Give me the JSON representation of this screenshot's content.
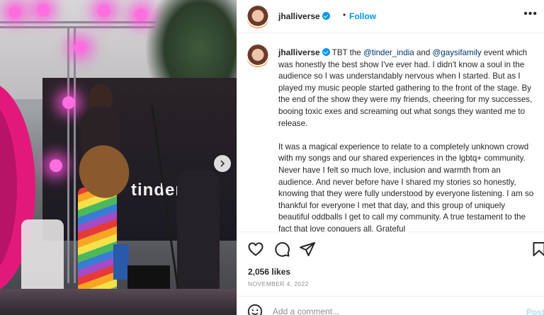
{
  "post": {
    "username": "jhalliverse",
    "follow_label": "Follow",
    "dot": "•",
    "more_label": "•••",
    "photo_brand_text": "tinder",
    "caption": {
      "intro": "TBT the",
      "mention1": "@tinder_india",
      "and": "and",
      "mention2": "@gaysifamily",
      "p1_rest": "event which was honestly the best show I've ever had. I didn't know a soul in the audience so I was understandably nervous when I started. But as I played my music people started gathering to the front of the stage. By the end of the show they were my friends, cheering for my successes, booing toxic exes and screaming out what songs they wanted me to release.",
      "p2": "It was a magical experience to relate to a completely unknown crowd with my songs and our shared experiences in the lgbtq+ community. Never have I felt so much love, inclusion and warmth from an audience. And never before have I shared my stories so honestly, knowing that they were fully understood by everyone listening. I am so thankful for everyone I met that day, and this group of uniquely beautiful oddballs I get to call my community. A true testament to the fact that love conquers all. Grateful"
    },
    "likes": "2,056 likes",
    "date": "NOVEMBER 4, 2022",
    "comment_placeholder": "Add a comment...",
    "post_label": "Post"
  },
  "icons": [
    "heart-icon",
    "comment-icon",
    "share-icon",
    "bookmark-icon",
    "emoji-icon",
    "chevron-right-icon",
    "verified-badge-icon"
  ],
  "colors": {
    "link": "#0095f6",
    "mention": "#00376b",
    "muted": "#8e8e8e",
    "stage_pink": "#e2197b"
  }
}
